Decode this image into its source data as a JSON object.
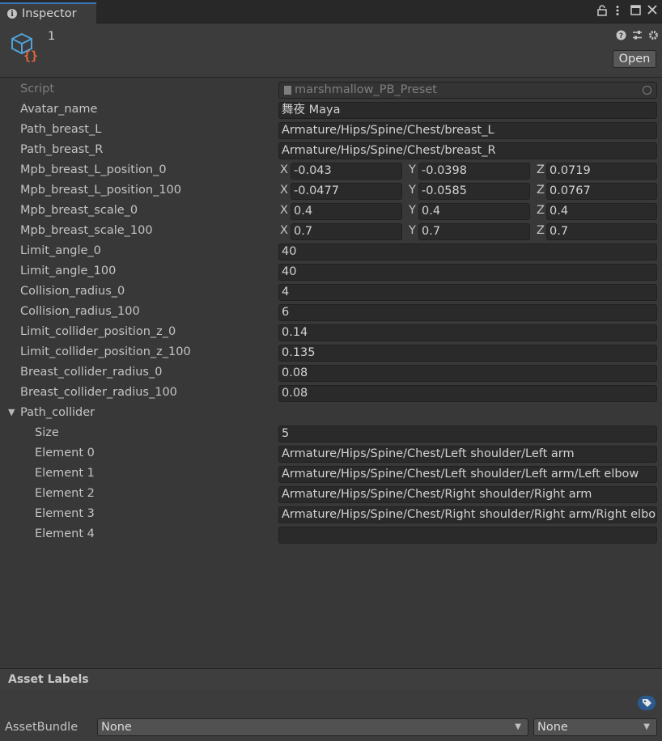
{
  "window": {
    "tab_title": "Inspector",
    "controls": {
      "lock": "lock-icon",
      "menu": "more-icon",
      "maximize": "maximize-icon",
      "close": "close-icon"
    }
  },
  "header": {
    "title": "1",
    "icon": "scriptable-object-icon",
    "open_label": "Open",
    "tools": [
      "help-icon",
      "preset-sliders-icon",
      "settings-gear-icon"
    ]
  },
  "script": {
    "label": "Script",
    "value": "marshmallow_PB_Preset"
  },
  "fields": [
    {
      "label": "Avatar_name",
      "value": "舞夜 Maya"
    },
    {
      "label": "Path_breast_L",
      "value": "Armature/Hips/Spine/Chest/breast_L"
    },
    {
      "label": "Path_breast_R",
      "value": "Armature/Hips/Spine/Chest/breast_R"
    }
  ],
  "vectors": [
    {
      "label": "Mpb_breast_L_position_0",
      "x": "-0.043",
      "y": "-0.0398",
      "z": "0.0719"
    },
    {
      "label": "Mpb_breast_L_position_100",
      "x": "-0.0477",
      "y": "-0.0585",
      "z": "0.0767"
    },
    {
      "label": "Mpb_breast_scale_0",
      "x": "0.4",
      "y": "0.4",
      "z": "0.4"
    },
    {
      "label": "Mpb_breast_scale_100",
      "x": "0.7",
      "y": "0.7",
      "z": "0.7"
    }
  ],
  "axis_labels": {
    "x": "X",
    "y": "Y",
    "z": "Z"
  },
  "numbers": [
    {
      "label": "Limit_angle_0",
      "value": "40"
    },
    {
      "label": "Limit_angle_100",
      "value": "40"
    },
    {
      "label": "Collision_radius_0",
      "value": "4"
    },
    {
      "label": "Collision_radius_100",
      "value": "6"
    },
    {
      "label": "Limit_collider_position_z_0",
      "value": "0.14"
    },
    {
      "label": "Limit_collider_position_z_100",
      "value": "0.135"
    },
    {
      "label": "Breast_collider_radius_0",
      "value": "0.08"
    },
    {
      "label": "Breast_collider_radius_100",
      "value": "0.08"
    }
  ],
  "path_collider": {
    "label": "Path_collider",
    "size_label": "Size",
    "size": "5",
    "elements": [
      {
        "label": "Element 0",
        "value": "Armature/Hips/Spine/Chest/Left shoulder/Left arm"
      },
      {
        "label": "Element 1",
        "value": "Armature/Hips/Spine/Chest/Left shoulder/Left arm/Left elbow"
      },
      {
        "label": "Element 2",
        "value": "Armature/Hips/Spine/Chest/Right shoulder/Right arm"
      },
      {
        "label": "Element 3",
        "value": "Armature/Hips/Spine/Chest/Right shoulder/Right arm/Right elbow"
      },
      {
        "label": "Element 4",
        "value": ""
      }
    ]
  },
  "asset_labels": {
    "title": "Asset Labels",
    "assetbundle_label": "AssetBundle",
    "bundle_value": "None",
    "variant_value": "None"
  },
  "colors": {
    "accent": "#3a79bb",
    "icon_blue": "#4fa3d8",
    "icon_orange": "#e8683a"
  }
}
